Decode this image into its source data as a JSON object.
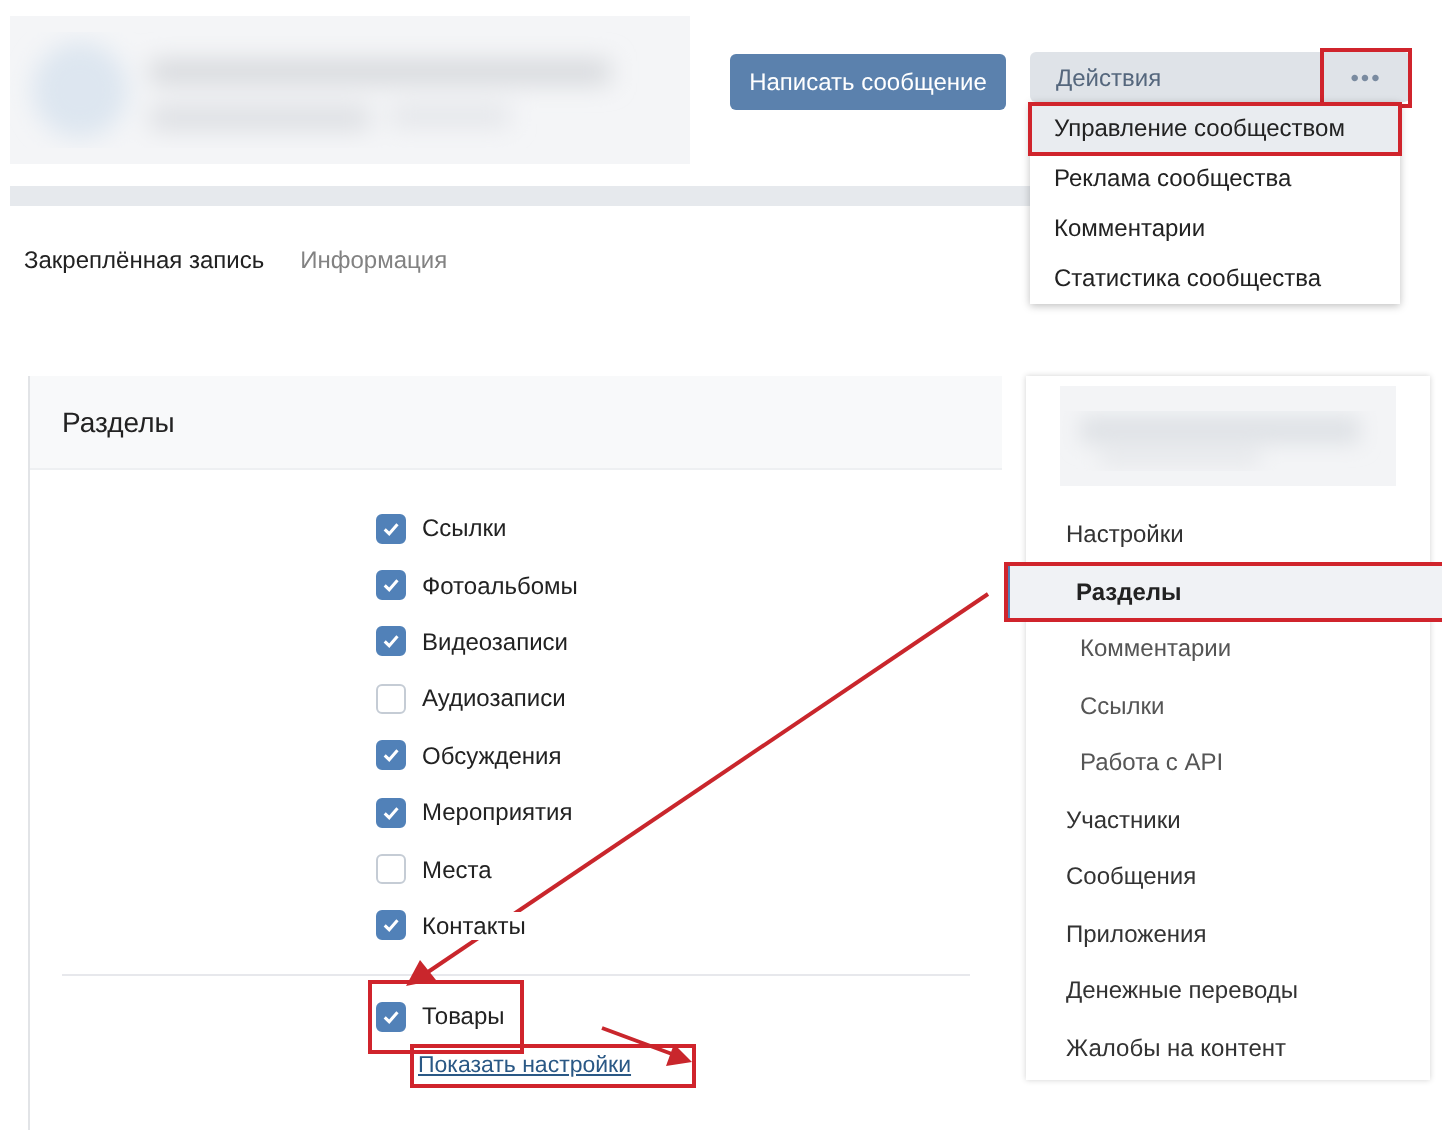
{
  "header": {
    "message_button": "Написать сообщение",
    "actions": {
      "label": "Действия",
      "more": "•••",
      "highlighted": true
    },
    "actions_menu": [
      {
        "label": "Управление сообществом",
        "highlighted": true
      },
      {
        "label": "Реклама сообщества",
        "highlighted": false
      },
      {
        "label": "Комментарии",
        "highlighted": false
      },
      {
        "label": "Статистика сообщества",
        "highlighted": false
      }
    ]
  },
  "tabs": [
    {
      "label": "Закреплённая запись",
      "selected": true
    },
    {
      "label": "Информация",
      "selected": false
    }
  ],
  "sections": {
    "title": "Разделы",
    "items": [
      {
        "label": "Ссылки",
        "checked": true
      },
      {
        "label": "Фотоальбомы",
        "checked": true
      },
      {
        "label": "Видеозаписи",
        "checked": true
      },
      {
        "label": "Аудиозаписи",
        "checked": false
      },
      {
        "label": "Обсуждения",
        "checked": true
      },
      {
        "label": "Мероприятия",
        "checked": true
      },
      {
        "label": "Места",
        "checked": false
      },
      {
        "label": "Контакты",
        "checked": true
      }
    ],
    "extra": [
      {
        "label": "Товары",
        "checked": true,
        "highlighted": true
      }
    ],
    "link": {
      "label": "Показать настройки",
      "highlighted": true
    }
  },
  "sidebar": {
    "items": [
      {
        "label": "Настройки",
        "selected": false,
        "highlighted": false,
        "children": [
          {
            "label": "Разделы",
            "selected": true,
            "highlighted": true
          },
          {
            "label": "Комментарии",
            "selected": false,
            "highlighted": false
          },
          {
            "label": "Ссылки",
            "selected": false,
            "highlighted": false
          },
          {
            "label": "Работа с API",
            "selected": false,
            "highlighted": false
          }
        ]
      },
      {
        "label": "Участники",
        "selected": false,
        "highlighted": false
      },
      {
        "label": "Сообщения",
        "selected": false,
        "highlighted": false
      },
      {
        "label": "Приложения",
        "selected": false,
        "highlighted": false
      },
      {
        "label": "Денежные переводы",
        "selected": false,
        "highlighted": false
      },
      {
        "label": "Жалобы на контент",
        "selected": false,
        "highlighted": false
      }
    ]
  }
}
